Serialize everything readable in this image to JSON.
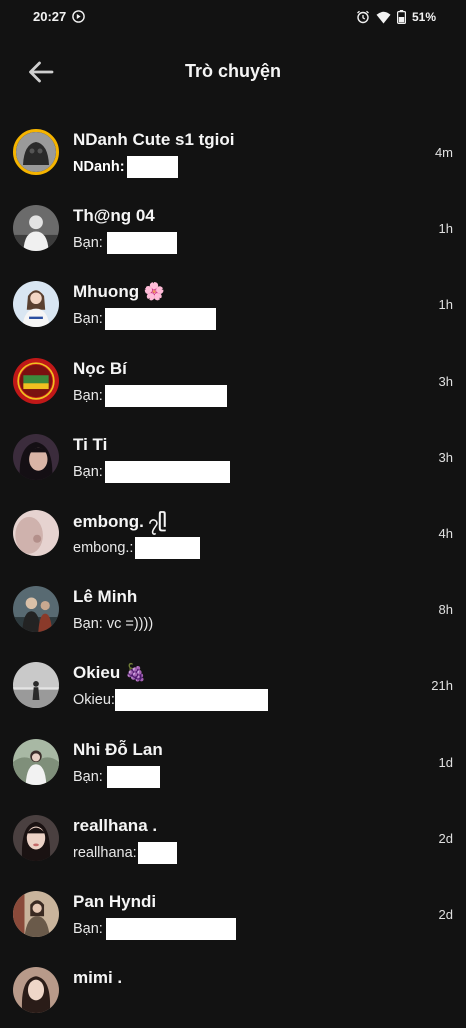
{
  "status_bar": {
    "time": "20:27",
    "battery": "51%",
    "icons": [
      "media-control-icon",
      "alarm-icon",
      "wifi-icon",
      "battery-icon"
    ]
  },
  "header": {
    "title": "Trò chuyện",
    "back_icon": "arrow-back-icon"
  },
  "colors": {
    "background": "#121212",
    "text": "#ffffff",
    "story_ring": "#f5b400",
    "redaction": "#ffffff"
  },
  "chats": [
    {
      "name": "NDanh Cute s1 tgioi",
      "preview_prefix": "NDanh:",
      "time": "4m",
      "unread": true,
      "story_ring": true
    },
    {
      "name": "Th@ng 04",
      "preview_prefix": "Bạn:",
      "time": "1h",
      "unread": false
    },
    {
      "name": "Mhuong 🌸",
      "preview_prefix": "Bạn:",
      "time": "1h",
      "unread": false
    },
    {
      "name": "Nọc Bí",
      "preview_prefix": "Bạn:",
      "time": "3h",
      "unread": false
    },
    {
      "name": "Ti Ti",
      "preview_prefix": "Bạn:",
      "time": "3h",
      "unread": false
    },
    {
      "name": "embong. ၇ᥫ",
      "preview_prefix": "embong.:",
      "time": "4h",
      "unread": false
    },
    {
      "name": "Lê Minh",
      "preview_prefix": "Bạn: vc =))))",
      "time": "8h",
      "unread": false
    },
    {
      "name": "Okieu 🍇",
      "preview_prefix": "Okieu:",
      "time": "21h",
      "unread": false
    },
    {
      "name": "Nhi Đỗ Lan",
      "preview_prefix": "Bạn:",
      "time": "1d",
      "unread": false
    },
    {
      "name": "reallhana .",
      "preview_prefix": "reallhana:",
      "time": "2d",
      "unread": false
    },
    {
      "name": "Pan Hyndi",
      "preview_prefix": "Bạn:",
      "time": "2d",
      "unread": false
    },
    {
      "name": "mimi .",
      "preview_prefix": "",
      "time": "",
      "unread": false
    }
  ]
}
